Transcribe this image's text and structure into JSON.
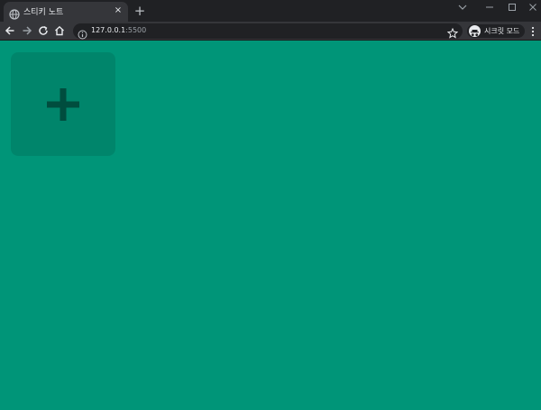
{
  "browser": {
    "tab_title": "스티키 노트",
    "tab_close_glyph": "×",
    "new_tab_glyph": "+",
    "url_host": "127.0.0.1",
    "url_port": ":5500",
    "incognito_label": "시크릿 모드"
  },
  "icons": {
    "favicon": "globe-icon",
    "back": "arrow-left-icon",
    "forward": "arrow-right-icon",
    "reload": "reload-icon",
    "home": "home-icon",
    "site_info": "info-icon",
    "bookmark": "star-icon",
    "incognito": "incognito-icon",
    "menu": "kebab-menu-icon",
    "add_note": "plus-icon"
  },
  "colors": {
    "page_background": "#009578",
    "add_note_tile": "rgba(0,0,0,0.1)",
    "plus": "#004d3e",
    "browser_frame": "#202124",
    "browser_toolbar": "#35363a"
  }
}
